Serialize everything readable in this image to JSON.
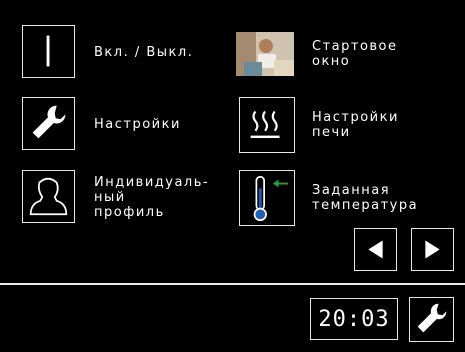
{
  "menu": {
    "items": [
      {
        "label": "Вкл. / Выкл.",
        "icon": "power-line-icon"
      },
      {
        "label": "Стартовое\nокно",
        "icon": "start-window-photo"
      },
      {
        "label": "Настройки",
        "icon": "wrench-icon"
      },
      {
        "label": "Настройки\nпечи",
        "icon": "heat-waves-icon"
      },
      {
        "label": "Индивидуаль-\nный\nпрофиль",
        "icon": "user-profile-icon"
      },
      {
        "label": "Заданная\nтемпература",
        "icon": "thermometer-icon"
      }
    ]
  },
  "nav": {
    "prev_icon": "left-arrow-icon",
    "next_icon": "right-arrow-icon"
  },
  "status_bar": {
    "time": "20:03",
    "settings_icon": "wrench-icon"
  },
  "colors": {
    "background": "#000000",
    "foreground": "#ffffff",
    "accent_green": "#2f9a3f",
    "thermo_blue": "#1e5fb4"
  }
}
